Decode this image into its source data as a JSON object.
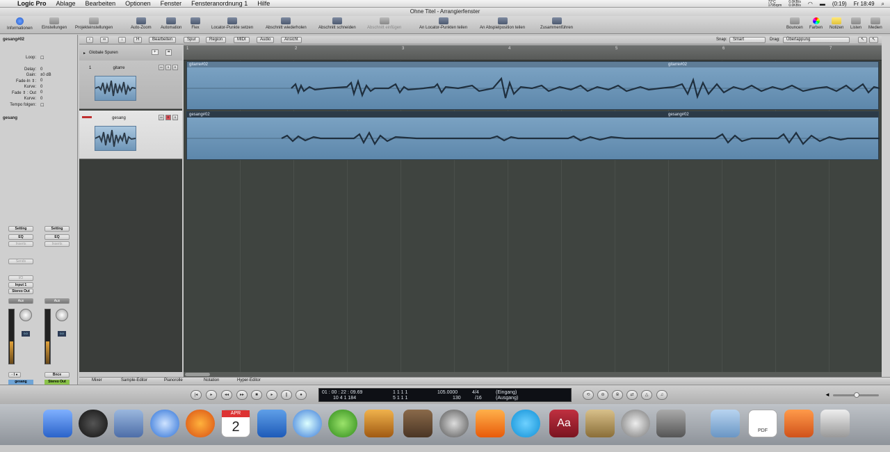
{
  "menubar": {
    "app": "Logic Pro",
    "items": [
      "Ablage",
      "Bearbeiten",
      "Optionen",
      "Fenster",
      "Fensteranordnung 1",
      "Hilfe"
    ],
    "status": {
      "temp": "72°C",
      "fan": "1795rpm",
      "net_up": "0.0KB/s",
      "net_down": "0.0KB/s",
      "battery": "(0:19)",
      "time": "Fr 18:49"
    }
  },
  "window": {
    "title": "Ohne Titel - Arrangierfenster"
  },
  "toolbar": {
    "informationen": "Informationen",
    "einstellungen": "Einstellungen",
    "projekteinstellungen": "Projekteinstellungen",
    "auto_zoom": "Auto-Zoom",
    "automation": "Automation",
    "flex": "Flex",
    "locator_punkte": "Locator-Punkte setzen",
    "abschnitt_wiederholen": "Abschnitt wiederholen",
    "abschnitt_schneiden": "Abschnitt schneiden",
    "abschnitt_einfuegen": "Abschnitt einfügen",
    "an_locator_teilen": "An Locator-Punkten teilen",
    "an_abspiel_teilen": "An Abspielposition teilen",
    "zusammenfuehren": "Zusammenführen",
    "bouncen": "Bouncen",
    "farben": "Farben",
    "notizen": "Notizen",
    "listen": "Listen",
    "medien": "Medien"
  },
  "inspector": {
    "region_name": "gesang#02",
    "loop_label": "Loop:",
    "rows": [
      {
        "label": "Delay:",
        "value": "0"
      },
      {
        "label": "Gain:",
        "value": "±0 dB"
      },
      {
        "label": "Fade-In ⇕:",
        "value": "0"
      },
      {
        "label": "Kurve:",
        "value": "0"
      },
      {
        "label": "Fade ⇕ : Out",
        "value": "0"
      },
      {
        "label": "Kurve:",
        "value": "0"
      },
      {
        "label": "Tempo folgen:",
        "value": ""
      }
    ],
    "track_name": "gesang",
    "strips": [
      {
        "setting": "Setting",
        "eq": "EQ",
        "inserts": "Inserts",
        "sends": "Sends",
        "io": "I/O",
        "input": "Input 1",
        "output": "Stereo Out",
        "aux": "Aux",
        "meter": "0.0",
        "bnc": "Bnce",
        "name": "gesang"
      },
      {
        "setting": "Setting",
        "eq": "EQ",
        "inserts": "Inserts",
        "sends": "",
        "io": "",
        "input": "",
        "output": "",
        "aux": "Aux",
        "meter": "0.0",
        "bnc": "Bnce",
        "name": "Stereo Out"
      }
    ]
  },
  "arrange_toolbar": {
    "menus": [
      "Bearbeiten",
      "Spur",
      "Region",
      "MIDI",
      "Audio",
      "Ansicht"
    ],
    "snap_label": "Snap:",
    "snap_value": "Smart",
    "drag_label": "Drag:",
    "drag_value": "Überlappung"
  },
  "tracklist": {
    "global": "Globale Spuren",
    "tracks": [
      {
        "num": "1",
        "name": "gitarre"
      },
      {
        "num": "2",
        "name": "gesang"
      }
    ]
  },
  "ruler": {
    "marks": [
      "1",
      "2",
      "3",
      "4",
      "5",
      "6",
      "7"
    ]
  },
  "regions": [
    {
      "name": "gitarre#02",
      "name2": "gitarre#02"
    },
    {
      "name": "gesang#02",
      "name2": "gesang#02"
    }
  ],
  "editors": [
    "Mixer",
    "Sample-Editor",
    "Pianorolle",
    "Notation",
    "Hyper-Editor"
  ],
  "transport": {
    "smpte": "01 : 00 : 22 : 09.69",
    "bars": "10   4   1  184",
    "loc1": "1   1   1   1",
    "loc2": "5   1   1   1",
    "tempo": "105.0000",
    "sig": "4/4",
    "div": "/16",
    "bpm_alt": "130",
    "in_label": "(Eingang)",
    "out_label": "(Ausgang)"
  },
  "dock": {
    "calendar_day": "2",
    "calendar_month": "APR",
    "dict_label": "Aa",
    "pdf_label": "PDF"
  }
}
